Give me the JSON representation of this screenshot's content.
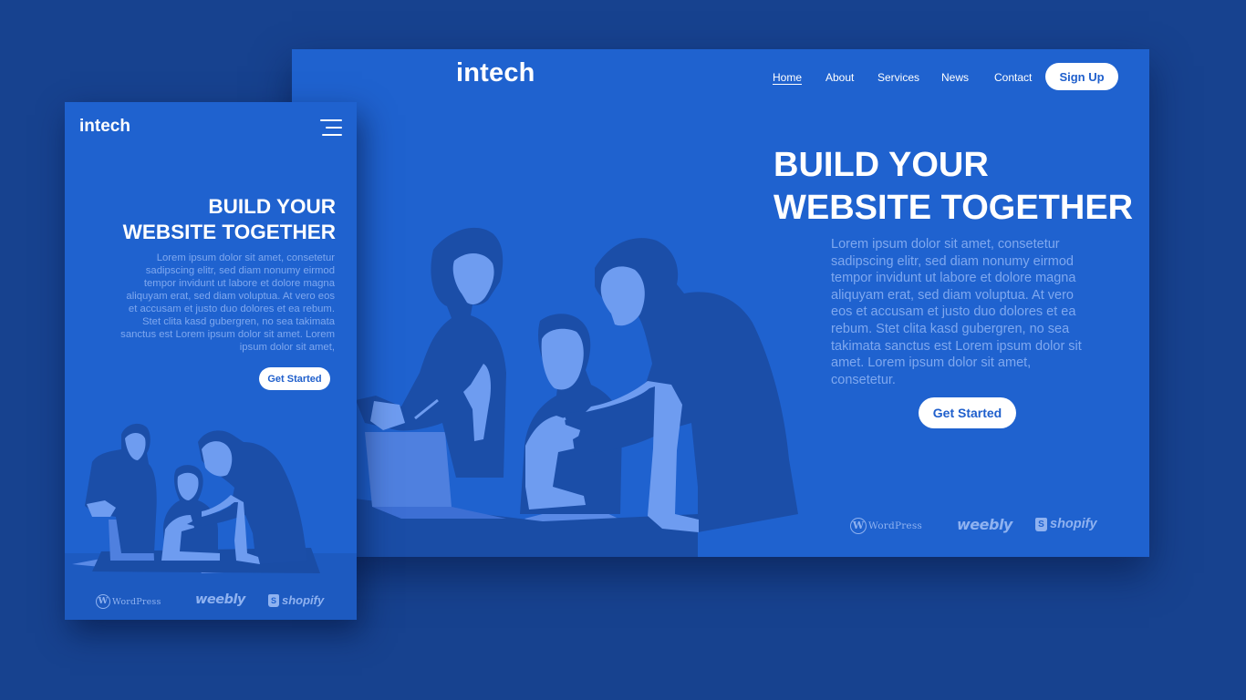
{
  "desktop": {
    "logo": "intech",
    "nav": [
      {
        "label": "Home",
        "active": true
      },
      {
        "label": "About",
        "active": false
      },
      {
        "label": "Services",
        "active": false
      },
      {
        "label": "News",
        "active": false
      },
      {
        "label": "Contact",
        "active": false
      }
    ],
    "signup_label": "Sign Up",
    "hero": {
      "title_line1": "BUILD YOUR",
      "title_line2": "WEBSITE TOGETHER",
      "body": "Lorem ipsum dolor sit amet, consetetur sadipscing elitr, sed diam nonumy eirmod tempor invidunt ut labore et dolore magna aliquyam erat, sed diam voluptua. At vero eos et accusam et justo duo dolores et ea rebum. Stet clita kasd gubergren, no sea takimata sanctus est Lorem ipsum dolor sit amet. Lorem ipsum dolor sit amet, consetetur.",
      "cta_label": "Get Started"
    },
    "brands": {
      "wordpress": "WordPress",
      "weebly": "weebly",
      "shopify": "shopify"
    }
  },
  "mobile": {
    "logo": "intech",
    "menu_icon": "hamburger-menu-icon",
    "hero": {
      "title_line1": "BUILD YOUR",
      "title_line2": "WEBSITE TOGETHER",
      "body": "Lorem ipsum dolor sit amet, consetetur sadipscing elitr, sed diam nonumy eirmod tempor invidunt ut labore et dolore magna aliquyam erat, sed diam voluptua. At vero eos et accusam et justo duo dolores et ea rebum. Stet clita kasd gubergren, no sea takimata sanctus est Lorem ipsum dolor sit amet. Lorem ipsum dolor sit amet,",
      "cta_label": "Get Started"
    },
    "brands": {
      "wordpress": "WordPress",
      "weebly": "weebly",
      "shopify": "shopify"
    }
  },
  "colors": {
    "background": "#17428f",
    "panel_blue": "#1f62cf",
    "text_muted": "#7fa8ef",
    "figure_light": "#6e9cf0",
    "figure_dark": "#1b4ea8",
    "white": "#ffffff"
  }
}
